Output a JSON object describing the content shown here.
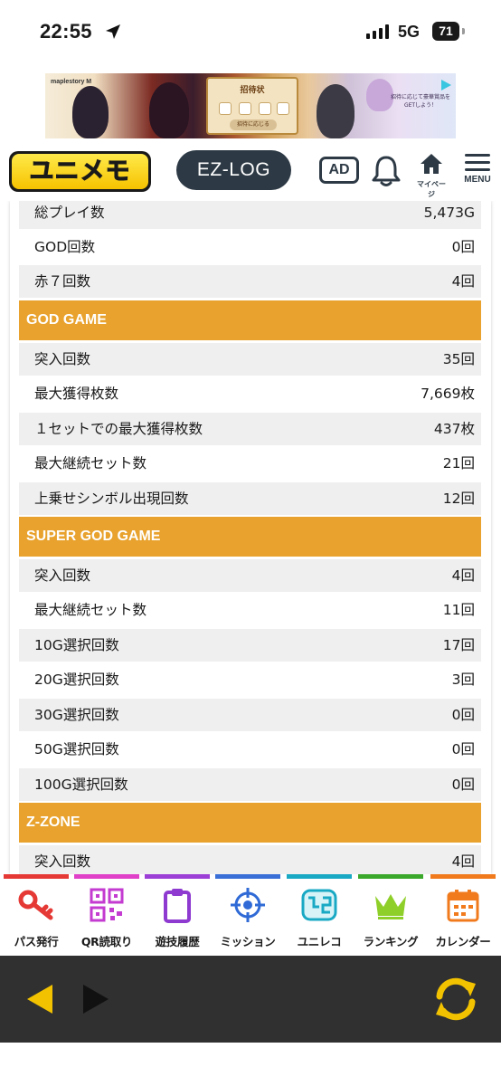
{
  "status": {
    "time": "22:55",
    "network": "5G",
    "battery": "71"
  },
  "banner": {
    "brand": "maplestory M",
    "card_title": "招待状",
    "card_button": "招待に応じる",
    "side_text": "招待に応じて豪華賞品をGETしよう！"
  },
  "header": {
    "logo": "ユニメモ",
    "ezlog": "EZ-LOG",
    "ad": "AD",
    "mypage": "マイページ",
    "menu": "MENU"
  },
  "stats": {
    "top_rows": [
      {
        "label": "総プレイ数",
        "value": "5,473G"
      },
      {
        "label": "GOD回数",
        "value": "0回"
      },
      {
        "label": "赤７回数",
        "value": "4回"
      }
    ],
    "sections": [
      {
        "title": "GOD GAME",
        "rows": [
          {
            "label": "突入回数",
            "value": "35回"
          },
          {
            "label": "最大獲得枚数",
            "value": "7,669枚"
          },
          {
            "label": "１セットでの最大獲得枚数",
            "value": "437枚"
          },
          {
            "label": "最大継続セット数",
            "value": "21回"
          },
          {
            "label": "上乗せシンボル出現回数",
            "value": "12回"
          }
        ]
      },
      {
        "title": "SUPER GOD GAME",
        "rows": [
          {
            "label": "突入回数",
            "value": "4回"
          },
          {
            "label": "最大継続セット数",
            "value": "11回"
          },
          {
            "label": "10G選択回数",
            "value": "17回"
          },
          {
            "label": "20G選択回数",
            "value": "3回"
          },
          {
            "label": "30G選択回数",
            "value": "0回"
          },
          {
            "label": "50G選択回数",
            "value": "0回"
          },
          {
            "label": "100G選択回数",
            "value": "0回"
          }
        ]
      },
      {
        "title": "Z-ZONE",
        "rows": [
          {
            "label": "突入回数",
            "value": "4回"
          }
        ]
      }
    ]
  },
  "bottom_nav": {
    "items": [
      {
        "label": "パス発行",
        "icon": "key-icon",
        "color": "#e53935"
      },
      {
        "label": "QR読取り",
        "icon": "qr-code-icon",
        "color": "#e040c8"
      },
      {
        "label": "遊技履歴",
        "icon": "clipboard-icon",
        "color": "#9c3fd6"
      },
      {
        "label": "ミッション",
        "icon": "target-icon",
        "color": "#3a6fd8"
      },
      {
        "label": "ユニレコ",
        "icon": "unireco-icon",
        "color": "#19a9c4"
      },
      {
        "label": "ランキング",
        "icon": "crown-icon",
        "color": "#3aa82a"
      },
      {
        "label": "カレンダー",
        "icon": "calendar-icon",
        "color": "#f07a1c"
      }
    ]
  },
  "colors": {
    "section_header": "#e8a22d",
    "row_alt": "#efefef",
    "toolbar": "#303030",
    "accent_yellow": "#f2c200"
  }
}
